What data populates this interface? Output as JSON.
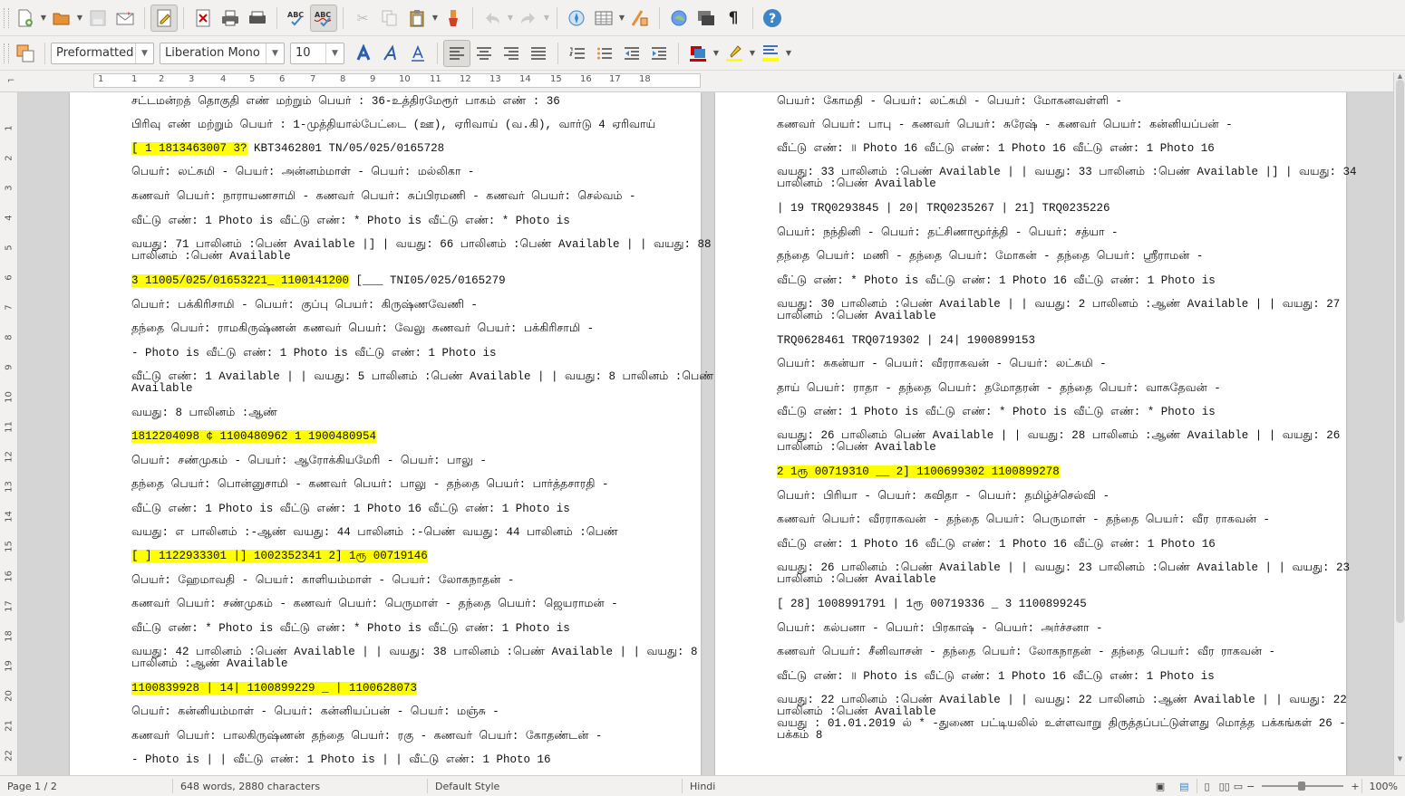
{
  "toolbar_standard": {
    "icons": [
      "new-document-icon",
      "open-icon",
      "save-icon",
      "email-icon",
      "edit-mode-icon",
      "export-pdf-icon",
      "print-icon",
      "print-preview-icon",
      "spellcheck-icon",
      "autospell-icon",
      "cut-icon",
      "copy-icon",
      "paste-icon",
      "clone-formatting-icon",
      "undo-icon",
      "redo-icon",
      "navigator-icon",
      "table-icon",
      "draw-functions-icon",
      "gallery-icon",
      "data-sources-icon",
      "formatting-marks-icon",
      "help-icon"
    ],
    "spell_label": "ABC",
    "pilcrow": "¶",
    "help_label": "?"
  },
  "toolbar_format": {
    "paragraph_style": "Preformatted",
    "font_name": "Liberation Mono",
    "font_size": "10"
  },
  "ruler": {
    "numbers": [
      "1",
      "1",
      "2",
      "3",
      "4",
      "5",
      "6",
      "7",
      "8",
      "9",
      "10",
      "11",
      "12",
      "13",
      "14",
      "15",
      "16",
      "17",
      "18"
    ]
  },
  "vruler": {
    "numbers": [
      "1",
      "2",
      "3",
      "4",
      "5",
      "6",
      "7",
      "8",
      "9",
      "10",
      "11",
      "12",
      "13",
      "14",
      "15",
      "16",
      "17",
      "18",
      "19",
      "20",
      "21",
      "22"
    ]
  },
  "page1": {
    "lines": [
      {
        "t": "சட்டமன்றத் தொகுதி எண் மற்றும் பெயர் : 36-உத்திரமேரூர் பாகம் எண் : 36"
      },
      {
        "t": "பிரிவு எண் மற்றும் பெயர் : 1-முத்தியால்பேட்டை (ஊ), ஏரிவாய் (வ.கி), வார்டு 4 ஏரிவாய்"
      },
      {
        "t": "[ 1 1813463007 3? KBT3462801 TN/05/025/0165728",
        "h": "0-17"
      },
      {
        "t": "பெயர்: லட்சுமி - பெயர்: அன்னம்மாள் - பெயர்: மல்லிகா -"
      },
      {
        "t": "கணவர் பெயர்: நாராயணசாமி - கணவர் பெயர்: சுப்பிரமணி - கணவர் பெயர்: செல்வம் -"
      },
      {
        "t": "வீட்டு எண்: 1 Photo is வீட்டு எண்: * Photo is வீட்டு எண்: * Photo is"
      },
      {
        "t": "வயது: 71 பாலினம் :பெண் Available |] | வயது: 66 பாலினம் :பெண் Available | | வயது: 88\nபாலினம் :பெண் Available"
      },
      {
        "t": "3 11005/025/01653221_ 1100141200 [___ TNI05/025/0165279",
        "h": "0-32"
      },
      {
        "t": "பெயர்: பக்கிரிசாமி - பெயர்: குப்பு பெயர்: கிருஷ்ணவேணி -"
      },
      {
        "t": "தந்தை பெயர்: ராமகிருஷ்ணன் கணவர் பெயர்: வேலு கணவர் பெயர்: பக்கிரிசாமி -"
      },
      {
        "t": "- Photo is வீட்டு எண்: 1 Photo is வீட்டு எண்: 1 Photo is"
      },
      {
        "t": "வீட்டு எண்: 1 Available | | வயது: 5 பாலினம் :பெண் Available | | வயது: 8 பாலினம் :பெண்\nAvailable"
      },
      {
        "t": "வயது: 8 பாலினம் :ஆண்"
      },
      {
        "t": "1812204098 ¢ 1100480962 1 1900480954",
        "h": "all"
      },
      {
        "t": "பெயர்: சண்முகம் - பெயர்: ஆரோக்கியமேரி - பெயர்: பாலு -"
      },
      {
        "t": "தந்தை பெயர்: பொன்னுசாமி - கணவர் பெயர்: பாலு - தந்தை பெயர்: பார்த்தசாரதி -"
      },
      {
        "t": "வீட்டு எண்: 1 Photo is வீட்டு எண்: 1 Photo 16 வீட்டு எண்: 1 Photo is"
      },
      {
        "t": "வயது: எ பாலினம் :-ஆண் வயது: 44 பாலினம் :-பெண் வயது: 44 பாலினம் :பெண்"
      },
      {
        "t": "[ ] 1122933301 |] 1002352341 2] 1ரூ 00719146",
        "h": "all"
      },
      {
        "t": "பெயர்: ஹேமாவதி - பெயர்: காளியம்மாள் - பெயர்: லோகநாதன் -"
      },
      {
        "t": "கணவர் பெயர்: சண்முகம் - கணவர் பெயர்: பெருமாள் - தந்தை பெயர்: ஜெயராமன் -"
      },
      {
        "t": "வீட்டு எண்: * Photo is வீட்டு எண்: * Photo is வீட்டு எண்: 1 Photo is"
      },
      {
        "t": "வயது: 42 பாலினம் :பெண் Available | | வயது: 38 பாலினம் :பெண் Available | | வயது: 8\nபாலினம் :ஆண் Available"
      },
      {
        "t": "1100839928 | 14| 1100899229 _ | 1100628073",
        "h": "all"
      },
      {
        "t": "பெயர்: கன்னியம்மாள் - பெயர்: கன்னியப்பன் - பெயர்: மஞ்சு -"
      },
      {
        "t": "கணவர் பெயர்: பாலகிருஷ்ணன் தந்தை பெயர்: ரகு - கணவர் பெயர்: கோதண்டன் -"
      },
      {
        "t": "- Photo is | | வீட்டு எண்: 1 Photo is | | வீட்டு எண்: 1 Photo 16"
      }
    ]
  },
  "page2": {
    "lines": [
      {
        "t": "பெயர்: கோமதி - பெயர்: லட்சுமி - பெயர்: மோகனவள்ளி -"
      },
      {
        "t": "கணவர் பெயர்: பாபு - கணவர் பெயர்: சுரேஷ் - கணவர் பெயர்: கன்னியப்பன் -"
      },
      {
        "t": "வீட்டு எண்: ॥ Photo 16 வீட்டு எண்: 1 Photo 16 வீட்டு எண்: 1 Photo 16"
      },
      {
        "t": "வயது: 33 பாலினம் :பெண் Available | | வயது: 33 பாலினம் :பெண் Available |] | வயது: 34\nபாலினம் :பெண் Available"
      },
      {
        "t": "| 19 TRQ0293845 | 20| TRQ0235267 | 21] TRQ0235226"
      },
      {
        "t": "பெயர்: நந்தினி - பெயர்: தட்சிணாமூர்த்தி - பெயர்: சத்யா -"
      },
      {
        "t": "தந்தை பெயர்: மணி - தந்தை பெயர்: மோகன் - தந்தை பெயர்: ஸ்ரீராமன் -"
      },
      {
        "t": "வீட்டு எண்: * Photo is வீட்டு எண்: 1 Photo 16 வீட்டு எண்: 1 Photo is"
      },
      {
        "t": "வயது: 30 பாலினம் :பெண் Available | | வயது: 2 பாலினம் :ஆண் Available | | வயது: 27\nபாலினம் :பெண் Available"
      },
      {
        "t": "TRQ0628461 TRQ0719302 | 24| 1900899153"
      },
      {
        "t": "பெயர்: சுகன்யா - பெயர்: வீரராகவன் - பெயர்: லட்சுமி -"
      },
      {
        "t": "தாய் பெயர்: ராதா - தந்தை பெயர்: தமோதரன் - தந்தை பெயர்: வாசுதேவன் -"
      },
      {
        "t": "வீட்டு எண்: 1 Photo is வீட்டு எண்: * Photo is வீட்டு எண்: * Photo is"
      },
      {
        "t": "வயது: 26 பாலினம் பெண் Available | | வயது: 28 பாலினம் :ஆண் Available | | வயது: 26\nபாலினம் :பெண் Available"
      },
      {
        "t": "2 1ரூ 00719310 __ 2] 1100699302 1100899278",
        "h": "all"
      },
      {
        "t": "பெயர்: பிரியா - பெயர்: கவிதா - பெயர்: தமிழ்ச்செல்வி -"
      },
      {
        "t": "கணவர் பெயர்: வீரராகவன் - தந்தை பெயர்: பெருமாள் - தந்தை பெயர்: வீர ராகவன் -"
      },
      {
        "t": "வீட்டு எண்: 1 Photo 16 வீட்டு எண்: 1 Photo 16 வீட்டு எண்: 1 Photo 16"
      },
      {
        "t": "வயது: 26 பாலினம் :பெண் Available | | வயது: 23 பாலினம் :பெண் Available | | வயது: 23\nபாலினம் :பெண் Available"
      },
      {
        "t": "[ 28] 1008991791 | 1ரூ 00719336 _ 3 1100899245"
      },
      {
        "t": "பெயர்: கல்பனா - பெயர்: பிரகாஷ் - பெயர்: அர்ச்சனா -"
      },
      {
        "t": "கணவர் பெயர்: சீனிவாசன் - தந்தை பெயர்: லோகநாதன் - தந்தை பெயர்: வீர ராகவன் -"
      },
      {
        "t": "வீட்டு எண்: ॥ Photo is வீட்டு எண்: 1 Photo 16 வீட்டு எண்: 1 Photo is"
      },
      {
        "t": "வயது: 22 பாலினம் :பெண் Available | | வயது: 22 பாலினம் :ஆண் Available | | வயது: 22\nபாலினம் :பெண் Available\nவயது : 01.01.2019 ல் * -துணை பட்டியலில் உள்ளவாறு திருத்தப்பட்டுள்ளது மொத்த பக்கங்கள் 26 -\nபக்கம் 8"
      }
    ]
  },
  "status": {
    "page": "Page 1 / 2",
    "words": "648 words, 2880 characters",
    "style": "Default Style",
    "language": "Hindi",
    "zoom": "100%"
  }
}
